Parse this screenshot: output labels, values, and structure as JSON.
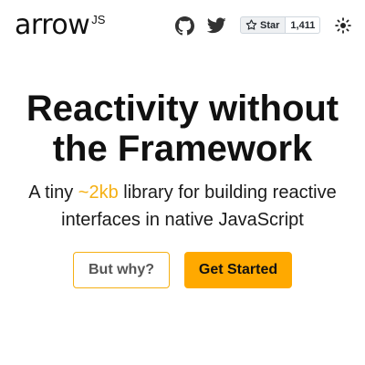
{
  "header": {
    "logo_text": "arrow",
    "logo_superscript": "JS",
    "github_star": {
      "label": "Star",
      "count": "1,411"
    },
    "icons": [
      "github-icon",
      "twitter-icon",
      "star-icon",
      "sun-icon"
    ]
  },
  "hero": {
    "title_line1": "Reactivity without",
    "title_line2": "the Framework",
    "subtitle_before": "A tiny ",
    "subtitle_accent": "~2kb",
    "subtitle_after": " library for building reactive interfaces in native JavaScript"
  },
  "actions": {
    "why_label": "But why?",
    "start_label": "Get Started"
  },
  "colors": {
    "accent": "#f5b014",
    "primary_button": "#ffa900",
    "text": "#111111",
    "background": "#ffffff"
  }
}
